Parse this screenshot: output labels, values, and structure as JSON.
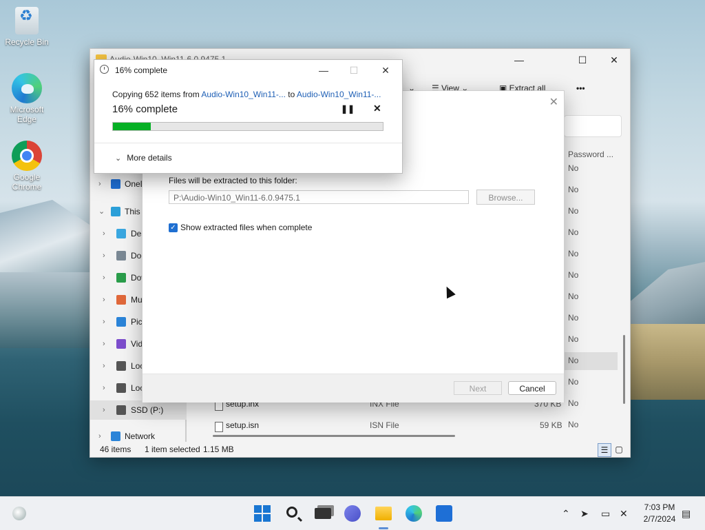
{
  "desktop": {
    "icons": [
      {
        "label": "Recycle Bin"
      },
      {
        "label": "Microsoft Edge"
      },
      {
        "label": "Google Chrome"
      }
    ]
  },
  "explorer": {
    "title": "Audio-Win10_Win11-6.0.9475.1",
    "toolbar": {
      "view": "View",
      "extract_all": "Extract all",
      "more": "•••"
    },
    "columns": {
      "password": "Password ..."
    },
    "password_values": [
      "No",
      "No",
      "No",
      "No",
      "No",
      "No",
      "No",
      "No",
      "No",
      "No",
      "No",
      "No",
      "No"
    ],
    "nav": [
      {
        "label": "OneDrive",
        "chev": "›"
      },
      {
        "label": "This PC",
        "chev": "⌄"
      },
      {
        "label": "Desktop",
        "chev": "›"
      },
      {
        "label": "Documents",
        "chev": "›"
      },
      {
        "label": "Downloads",
        "chev": "›"
      },
      {
        "label": "Music",
        "chev": "›"
      },
      {
        "label": "Pictures",
        "chev": "›"
      },
      {
        "label": "Videos",
        "chev": "›"
      },
      {
        "label": "Local Disk",
        "chev": "›"
      },
      {
        "label": "Local Disk",
        "chev": "›"
      },
      {
        "label": "SSD (P:)",
        "chev": "›"
      },
      {
        "label": "Network",
        "chev": "›"
      }
    ],
    "files": [
      {
        "name": "setup.inx",
        "type": "INX File",
        "size": "370 KB"
      },
      {
        "name": "setup.isn",
        "type": "ISN File",
        "size": "59 KB"
      }
    ],
    "status": {
      "count": "46 items",
      "selected": "1 item selected",
      "size": "1.15 MB"
    }
  },
  "wizard": {
    "close": "✕",
    "folder_label": "Files will be extracted to this folder:",
    "path": "P:\\Audio-Win10_Win11-6.0.9475.1",
    "browse": "Browse...",
    "show_files_label": "Show extracted files when complete",
    "next": "Next",
    "cancel": "Cancel"
  },
  "progress": {
    "title": "16% complete",
    "copy_prefix": "Copying 652 items from ",
    "source": "Audio-Win10_Win11-...",
    "copy_mid": " to ",
    "dest": "Audio-Win10_Win11-...",
    "percent_text": "16% complete",
    "percent_value": 0.14,
    "more_details": "More details"
  },
  "taskbar": {
    "time": "7:03 PM",
    "date": "2/7/2024"
  }
}
